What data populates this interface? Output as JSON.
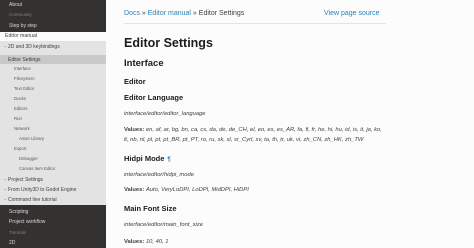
{
  "sidebar": {
    "top_items": [
      "About",
      "Community",
      "Step by step",
      "Editor manual"
    ],
    "light_items": [
      {
        "label": "2D and 3D keybindings",
        "level": 1,
        "toggle": "+"
      },
      {
        "label": "Editor Settings",
        "level": 1,
        "toggle": "-"
      },
      {
        "label": "Interface",
        "level": 2
      },
      {
        "label": "Filesystem",
        "level": 2
      },
      {
        "label": "Text Editor",
        "level": 2
      },
      {
        "label": "Docks",
        "level": 2
      },
      {
        "label": "Editors",
        "level": 2
      },
      {
        "label": "Run",
        "level": 2
      },
      {
        "label": "Network",
        "level": 2
      },
      {
        "label": "Asset Library",
        "level": 3
      },
      {
        "label": "Export",
        "level": 2
      },
      {
        "label": "Debugger",
        "level": 3
      },
      {
        "label": "Canvas item Editor",
        "level": 3
      },
      {
        "label": "Project Settings",
        "level": 1,
        "toggle": "+"
      },
      {
        "label": "From Unity3D to Godot Engine",
        "level": 1,
        "toggle": "+"
      },
      {
        "label": "Command line tutorial",
        "level": 1,
        "toggle": "+"
      }
    ],
    "bottom_items": [
      "Scripting",
      "Project workflow",
      "Tutorials",
      "2D"
    ]
  },
  "breadcrumb": {
    "home": "Docs",
    "sep1": "»",
    "parent": "Editor manual",
    "sep2": "»",
    "current": "Editor Settings"
  },
  "view_source": "View page source",
  "content": {
    "title": "Editor Settings",
    "section": "Interface",
    "subsection": "Editor",
    "prop1": {
      "name": "Editor Language",
      "path": "interface/editor/editor_language",
      "values_label": "Values:",
      "values": "en, af, ar, bg, bn, ca, cs, da, de, de_CH, el, eo, es, es_AR, fa, fi, fr, he, hi, hu, id, is, it, ja, ko, lt, nb, nl, pl, pt, pt_BR, pt_PT, ro, ru, sk, sl, sr_Cyrl, sv, ta, th, tr, uk, vi, zh_CN, zh_HK, zh_TW"
    },
    "prop2": {
      "name": "Hidpi Mode",
      "pin": "¶",
      "path": "interface/editor/hidpi_mode",
      "values_label": "Values:",
      "values": "Auto, VeryLoDPI, LoDPI, MidDPI, HiDPI"
    },
    "prop3": {
      "name": "Main Font Size",
      "path": "interface/editor/main_font_size",
      "values_label": "Values:",
      "values": "10, 40, 1"
    }
  }
}
